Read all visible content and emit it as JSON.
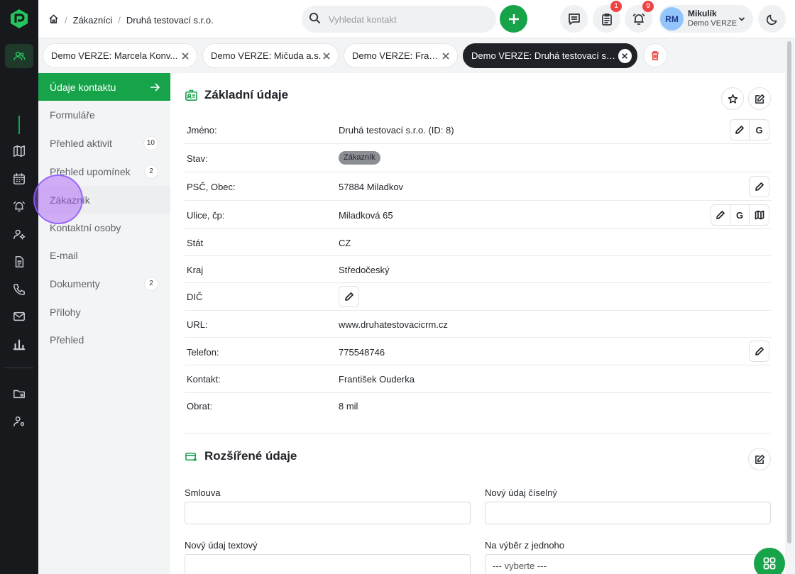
{
  "header": {
    "breadcrumb": [
      "Zákazníci",
      "Druhá testovací s.r.o."
    ],
    "search_placeholder": "Vyhledat kontakt",
    "badges": {
      "tasks": "1",
      "reminders": "9"
    },
    "user": {
      "initials": "RM",
      "name": "Mikulík",
      "org": "Demo VERZE"
    }
  },
  "tabs": [
    {
      "label": "Demo VERZE: Marcela Konv..."
    },
    {
      "label": "Demo VERZE: Mičuda a.s."
    },
    {
      "label": "Demo VERZE: Franta"
    },
    {
      "label": "Demo VERZE: Druhá testovací s.r.o."
    }
  ],
  "sections": [
    {
      "label": "Údaje kontaktu",
      "count": ""
    },
    {
      "label": "Formuláře",
      "count": ""
    },
    {
      "label": "Přehled aktivit",
      "count": "10"
    },
    {
      "label": "Přehled upomínek",
      "count": "2"
    },
    {
      "label": "Zákazník",
      "count": ""
    },
    {
      "label": "Kontaktní osoby",
      "count": ""
    },
    {
      "label": "E-mail",
      "count": ""
    },
    {
      "label": "Dokumenty",
      "count": "2"
    },
    {
      "label": "Přílohy",
      "count": ""
    },
    {
      "label": "Přehled",
      "count": ""
    }
  ],
  "basic": {
    "title": "Základní údaje",
    "rows": [
      {
        "key": "Jméno:",
        "value": "Druhá testovací s.r.o. (ID: 8)"
      },
      {
        "key": "Stav:",
        "value": "Zákazník"
      },
      {
        "key": "PSČ, Obec:",
        "value": "57884 Miladkov"
      },
      {
        "key": "Ulice, čp:",
        "value": "Miladková 65"
      },
      {
        "key": "Stát",
        "value": "CZ"
      },
      {
        "key": "Kraj",
        "value": "Středočeský"
      },
      {
        "key": "DIČ",
        "value": ""
      },
      {
        "key": "URL:",
        "value": "www.druhatestovacicrm.cz"
      },
      {
        "key": "Telefon:",
        "value": "775548746"
      },
      {
        "key": "Kontakt:",
        "value": "František Ouderka"
      },
      {
        "key": "Obrat:",
        "value": "8 mil"
      }
    ],
    "google_letter": "G"
  },
  "extended": {
    "title": "Rozšířené údaje",
    "fields": [
      {
        "label": "Smlouva",
        "value": ""
      },
      {
        "label": "Nový údaj číselný",
        "value": ""
      },
      {
        "label": "Nový údaj textový",
        "value": ""
      },
      {
        "label": "Na výběr z jednoho",
        "value": "--- vyberte ---"
      }
    ]
  },
  "colors": {
    "accent": "#16a34a",
    "rail": "#17191c",
    "badge": "#ef4444"
  }
}
